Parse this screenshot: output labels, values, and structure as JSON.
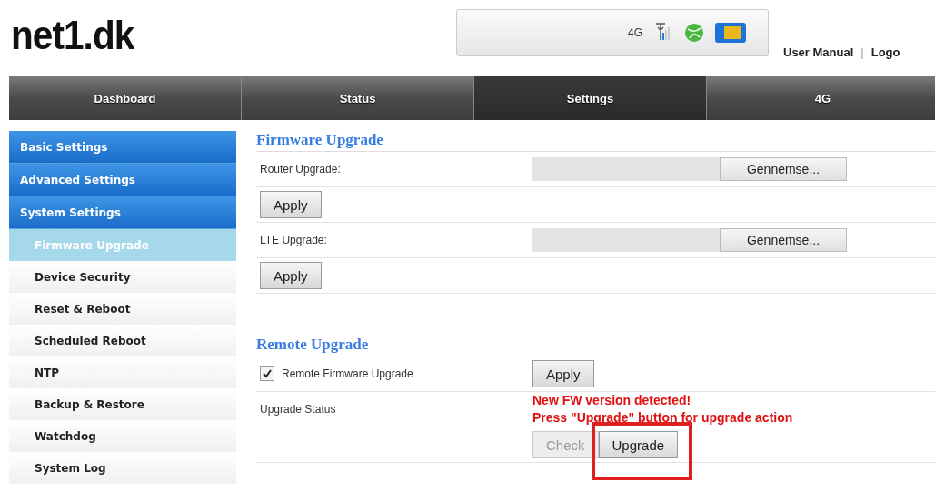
{
  "logo": "net1.dk",
  "status_box": {
    "network": "4G"
  },
  "header_links": {
    "items": [
      "User Manual",
      "Logo"
    ],
    "separator": "|"
  },
  "tabs": [
    {
      "label": "Dashboard",
      "selected": false
    },
    {
      "label": "Status",
      "selected": false
    },
    {
      "label": "Settings",
      "selected": true
    },
    {
      "label": "4G",
      "selected": false
    }
  ],
  "sidebar": {
    "items": [
      {
        "label": "Basic Settings",
        "selected": false
      },
      {
        "label": "Advanced Settings",
        "selected": false
      },
      {
        "label": "System Settings",
        "selected": false,
        "expanded": true,
        "children": [
          {
            "label": "Firmware Upgrade",
            "selected": true
          },
          {
            "label": "Device Security",
            "selected": false
          },
          {
            "label": "Reset & Reboot",
            "selected": false
          },
          {
            "label": "Scheduled Reboot",
            "selected": false
          },
          {
            "label": "NTP",
            "selected": false
          },
          {
            "label": "Backup & Restore",
            "selected": false
          },
          {
            "label": "Watchdog",
            "selected": false
          },
          {
            "label": "System Log",
            "selected": false
          }
        ]
      }
    ]
  },
  "firmware_upgrade": {
    "title": "Firmware Upgrade",
    "rows": [
      {
        "label": "Router Upgrade:",
        "browse": "Gennemse...",
        "apply": "Apply"
      },
      {
        "label": "LTE Upgrade:",
        "browse": "Gennemse...",
        "apply": "Apply"
      }
    ]
  },
  "remote_upgrade": {
    "title": "Remote Upgrade",
    "checkbox": {
      "label": "Remote Firmware Upgrade",
      "checked": true
    },
    "apply": "Apply",
    "status_label": "Upgrade Status",
    "status_messages": [
      "New FW version detected!",
      "Press \"Upgrade\" button for upgrade action"
    ],
    "buttons": [
      {
        "label": "Check",
        "disabled": true,
        "highlighted": false
      },
      {
        "label": "Upgrade",
        "disabled": false,
        "highlighted": true
      }
    ]
  }
}
